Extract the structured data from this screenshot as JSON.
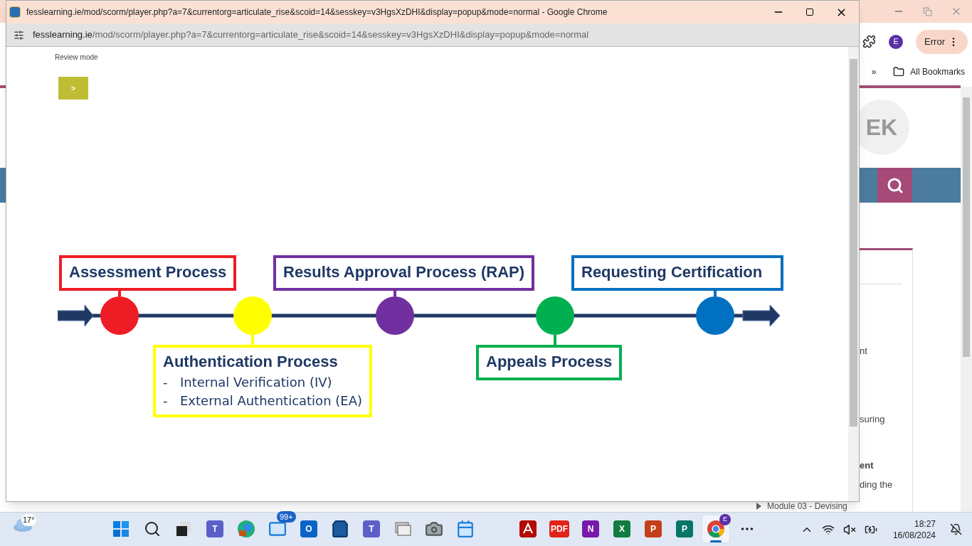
{
  "popup": {
    "title": "fesslearning.ie/mod/scorm/player.php?a=7&currentorg=articulate_rise&scoid=14&sesskey=v3HgsXzDHI&display=popup&mode=normal - Google Chrome",
    "address": {
      "host": "fesslearning.ie",
      "path": "/mod/scorm/player.php?a=7&currentorg=articulate_rise&scoid=14&sesskey=v3HgsXzDHI&display=popup&mode=normal"
    },
    "review_mode": "Review mode",
    "next_button": ">",
    "timeline": [
      {
        "label": "Assessment Process",
        "color": "#ee1c25"
      },
      {
        "label": "Authentication Process",
        "color": "#ffff00",
        "lines": [
          "Internal Verification (IV)",
          "External Authentication (EA)"
        ],
        "bullet": "-"
      },
      {
        "label": "Results Approval Process (RAP)",
        "color": "#7030a0"
      },
      {
        "label": "Appeals Process",
        "color": "#00b050"
      },
      {
        "label": "Requesting Certification",
        "color": "#0070c0"
      }
    ]
  },
  "background": {
    "profile_initial": "E",
    "error_button": "Error",
    "bookmarks_more": "»",
    "bookmarks": "All Bookmarks",
    "avatar": "EK",
    "fragments": [
      {
        "text": "nt",
        "bold": false
      },
      {
        "text": "suring",
        "bold": false
      },
      {
        "text": "ent",
        "bold": true
      },
      {
        "text": "ding the",
        "bold": false
      }
    ],
    "module_item": "Module 03 - Devising"
  },
  "taskbar": {
    "weather": "17°",
    "apps": [
      {
        "kind": "start"
      },
      {
        "kind": "search"
      },
      {
        "kind": "taskview"
      },
      {
        "kind": "tile",
        "glyph": "T",
        "color": "#5b5fc7"
      },
      {
        "kind": "edge"
      },
      {
        "kind": "mail",
        "badge": "99+"
      },
      {
        "kind": "tile",
        "glyph": "O",
        "color": "#0a64c8"
      },
      {
        "kind": "store"
      },
      {
        "kind": "tile",
        "glyph": "T",
        "color": "#5b5fc7"
      },
      {
        "kind": "files"
      },
      {
        "kind": "camera"
      },
      {
        "kind": "calendar"
      },
      {
        "kind": "acrobat"
      },
      {
        "kind": "tile",
        "glyph": "PDF",
        "color": "#e2231a"
      },
      {
        "kind": "tile",
        "glyph": "N",
        "color": "#7719aa"
      },
      {
        "kind": "tile",
        "glyph": "X",
        "color": "#107c41"
      },
      {
        "kind": "tile",
        "glyph": "P",
        "color": "#c43e1c"
      },
      {
        "kind": "tile",
        "glyph": "P",
        "color": "#077568"
      },
      {
        "kind": "chrome",
        "badge": "E",
        "selected": true
      },
      {
        "kind": "more"
      }
    ],
    "time": "18:27",
    "date": "16/08/2024"
  }
}
